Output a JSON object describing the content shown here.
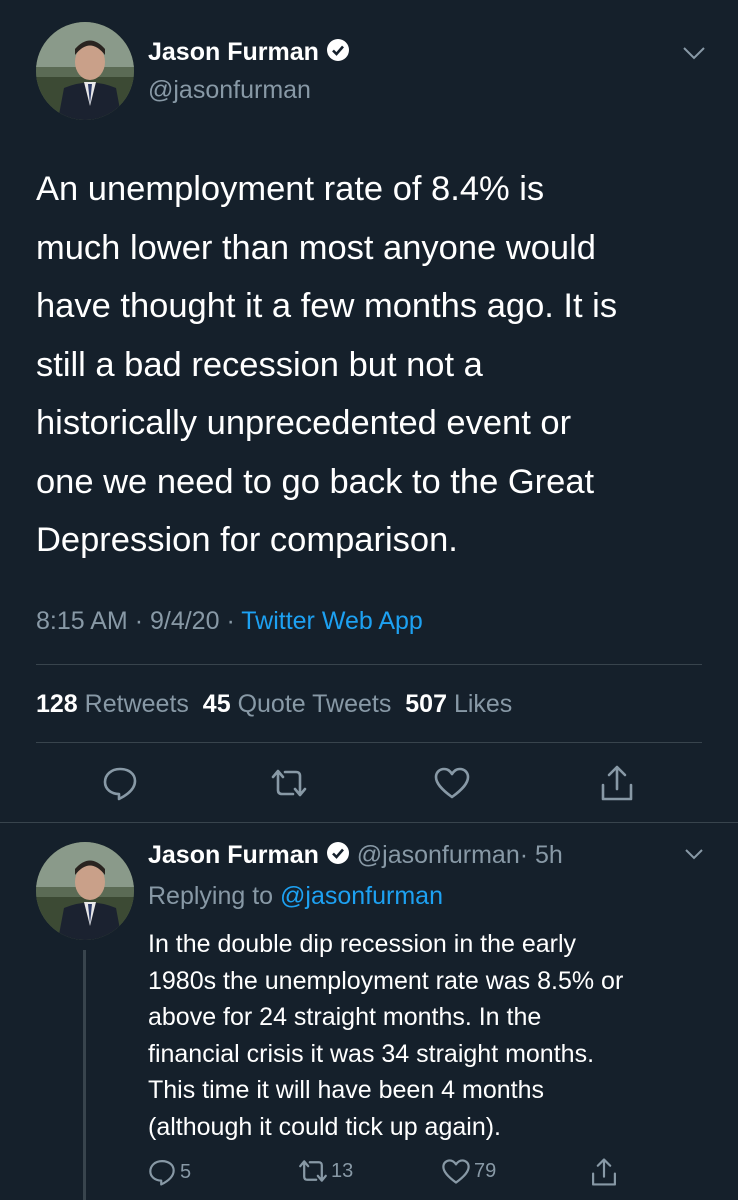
{
  "tweet": {
    "author_name": "Jason Furman",
    "author_handle": "@jasonfurman",
    "text_lines": [
      "An unemployment rate of 8.4% is",
      "much lower than most anyone would",
      "have thought it a few months ago. It is",
      "still a  bad recession but not a",
      "historically unprecedented event or",
      "one we need to go back to the Great",
      "Depression for comparison."
    ],
    "time": "8:15 AM",
    "date": "9/4/20",
    "separator": "·",
    "source": "Twitter Web App",
    "retweets_count": "128",
    "retweets_label": "Retweets",
    "quote_count": "45",
    "quote_label": "Quote Tweets",
    "likes_count": "507",
    "likes_label": "Likes"
  },
  "reply": {
    "author_name": "Jason Furman",
    "author_handle": "@jasonfurman",
    "time_ago": "· 5h",
    "replying_label": "Replying to",
    "replying_handle": "@jasonfurman",
    "text_lines": [
      "In the double dip recession in the early",
      "1980s the unemployment rate was 8.5% or",
      "above for 24 straight months. In the",
      "financial crisis it was 34 straight months.",
      "This time it will have been 4 months",
      "(although it could tick up again)."
    ],
    "reply_count": "5",
    "retweet_count": "13",
    "like_count": "79"
  },
  "colors": {
    "background": "#15202b",
    "muted": "#8899a6",
    "link": "#1da1f2",
    "divider": "#38444d"
  },
  "icons": [
    "chevron-down-icon",
    "verified-icon",
    "reply-icon",
    "retweet-icon",
    "like-icon",
    "share-icon"
  ]
}
